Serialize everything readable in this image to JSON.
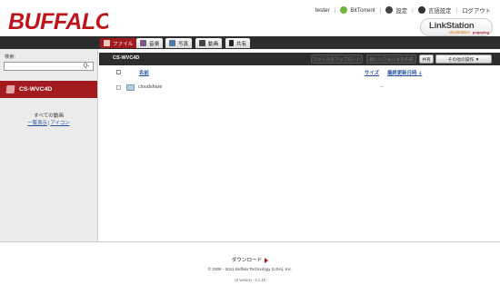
{
  "header": {
    "logo": "BUFFALO",
    "user": "tester",
    "nav": [
      {
        "label": "BitTorrent",
        "icon": "bittorrent-icon"
      },
      {
        "label": "設定",
        "icon": "gear-icon"
      },
      {
        "label": "言語設定",
        "icon": "globe-icon"
      },
      {
        "label": "ログアウト"
      }
    ],
    "product": {
      "name": "LinkStation",
      "edition": "cloudEdition",
      "badge": "pogoplug"
    }
  },
  "tabs": [
    {
      "label": "ファイル",
      "icon": "folder-icon",
      "active": true
    },
    {
      "label": "音楽",
      "icon": "music-icon"
    },
    {
      "label": "写真",
      "icon": "photo-icon"
    },
    {
      "label": "動画",
      "icon": "video-icon"
    },
    {
      "label": "共有",
      "icon": "share-icon"
    }
  ],
  "sidebar": {
    "search_label": "検索:",
    "search_value": "",
    "search_button": "Q-",
    "device": "CS-WVC4D",
    "all_videos": "すべての動画",
    "view_list": "一覧表示",
    "view_sep": "|",
    "view_icon": "アイコン"
  },
  "toolbar": {
    "title": "CS-WVC4D",
    "buttons": [
      {
        "label": "ファイルをアップロード",
        "enabled": false
      },
      {
        "label": "新しいフォルダを作成",
        "enabled": false
      },
      {
        "label": "共有",
        "enabled": true
      },
      {
        "label": "その他の操作 ▼",
        "enabled": true
      }
    ]
  },
  "table": {
    "columns": {
      "name": "名前",
      "size": "サイズ",
      "date": "最終更新日時 ⇣"
    },
    "rows": [
      {
        "name": "cloudshare",
        "size": "",
        "date": "--"
      }
    ]
  },
  "footer": {
    "download": "ダウンロード",
    "copyright": "© 2006 - 2011 Buffalo Technology (USA), Inc.",
    "version": "UI version : 3.1.15"
  },
  "colors": {
    "brand": "#c0141b",
    "accent": "#a31b1f",
    "dark_bar": "#2d2d2d",
    "link": "#2a55a6"
  }
}
